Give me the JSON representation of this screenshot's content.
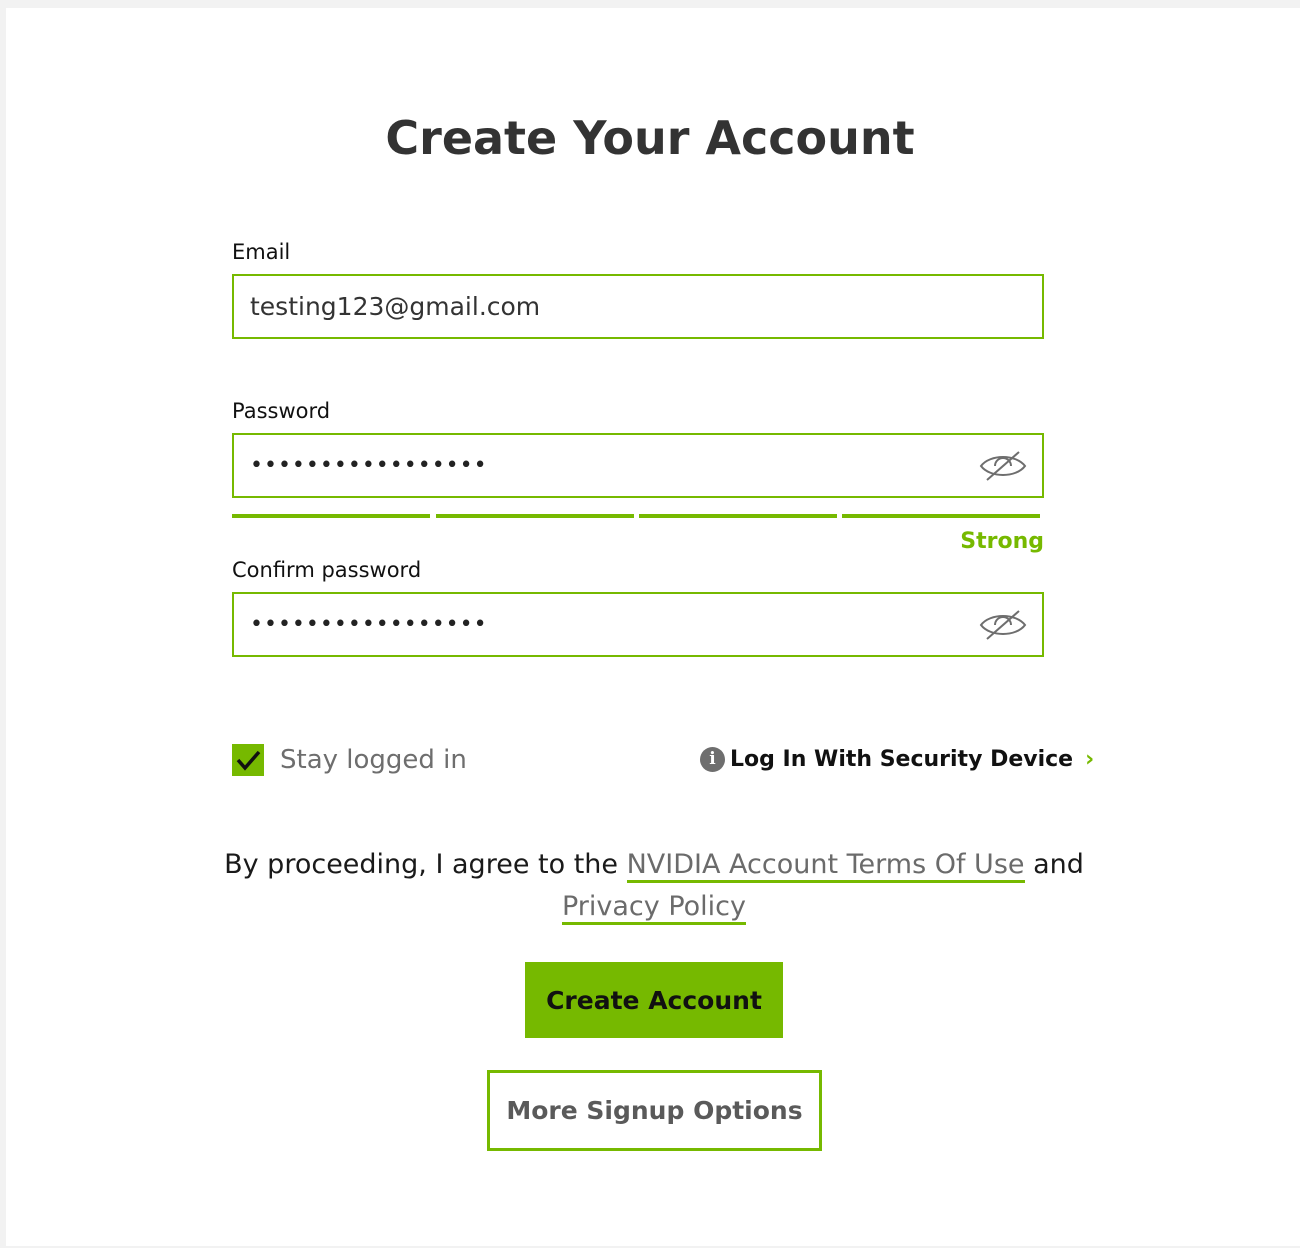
{
  "page": {
    "title": "Create Your Account"
  },
  "form": {
    "email": {
      "label": "Email",
      "value": "testing123@gmail.com"
    },
    "password": {
      "label": "Password",
      "value": "•••••••••••••••••",
      "toggle_icon": "eye-slash-icon"
    },
    "strength": {
      "label": "Strong",
      "segments_filled": 4,
      "segments_total": 4
    },
    "confirm_password": {
      "label": "Confirm password",
      "value": "•••••••••••••••••",
      "toggle_icon": "eye-slash-icon"
    }
  },
  "options": {
    "stay_logged_in": {
      "label": "Stay logged in",
      "checked": true
    },
    "security_device": {
      "icon": "info-icon",
      "icon_glyph": "i",
      "label": "Log In With Security Device",
      "chevron": "›"
    }
  },
  "terms": {
    "prefix": "By proceeding, I agree to the ",
    "terms_link": "NVIDIA Account Terms Of Use",
    "middle": " and ",
    "privacy_link": "Privacy Policy"
  },
  "actions": {
    "create_label": "Create Account",
    "more_options_label": "More Signup Options"
  },
  "colors": {
    "accent": "#76b900",
    "text_dark": "#333333",
    "text_muted": "#6e6e6e",
    "background": "#f2f2f2",
    "card": "#ffffff"
  }
}
